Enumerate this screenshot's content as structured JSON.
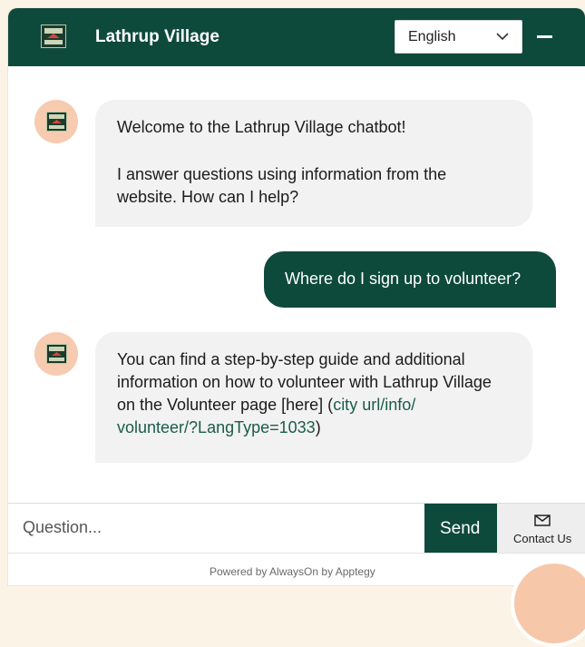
{
  "header": {
    "title": "Lathrup Village",
    "language": "English",
    "logo_text": "Lathrup Village"
  },
  "messages": {
    "bot1": {
      "line1": "Welcome to the Lathrup Village chatbot!",
      "line2": "I answer questions using information from the website. How can I help?"
    },
    "user1": "Where do I sign up to volunteer?",
    "bot2": {
      "text": "You can find a step-by-step guide and additional information on how to volunteer with Lathrup Village on the Volunteer page [here] (",
      "link_line1": "city url/info/",
      "link_line2": "volunteer/?LangType=1033",
      "after": ")"
    }
  },
  "input": {
    "placeholder": "Question...",
    "send_label": "Send",
    "contact_label": "Contact Us"
  },
  "footer": "Powered by AlwaysOn by Apptegy",
  "colors": {
    "brand": "#0e4a3c",
    "avatar_bg": "#f6cbb0",
    "bot_bubble": "#f2f2f2"
  },
  "icons": [
    "village-logo-icon",
    "chevron-down-icon",
    "minimize-icon",
    "envelope-icon"
  ]
}
